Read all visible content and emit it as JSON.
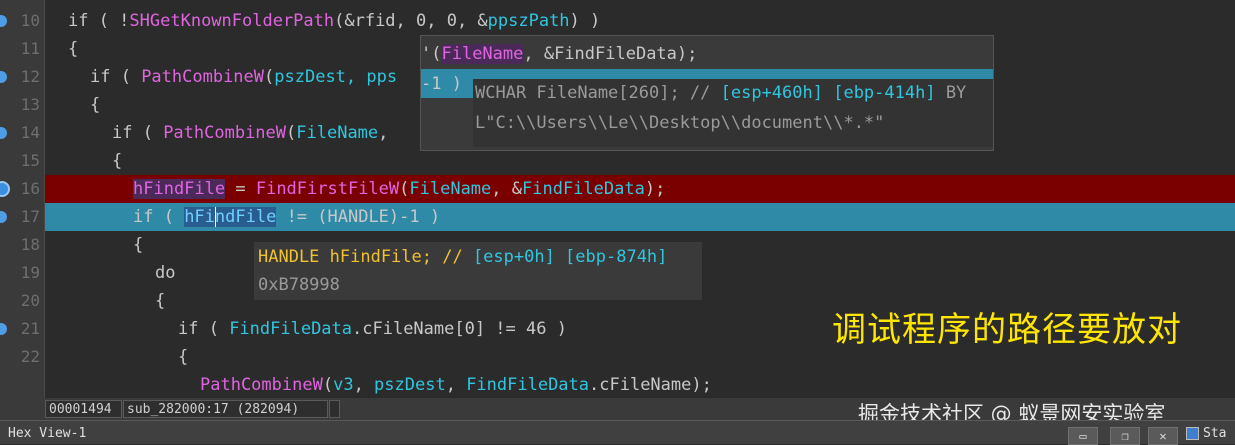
{
  "line_numbers": [
    "10",
    "11",
    "12",
    "13",
    "14",
    "15",
    "16",
    "17",
    "18",
    "19",
    "20",
    "21",
    "22"
  ],
  "code": {
    "l10": {
      "a": "if ( !",
      "fn": "SHGetKnownFolderPath",
      "b": "(&rfid, 0, 0, &",
      "v": "ppszPath",
      "c": ") )"
    },
    "l11": {
      "a": "{"
    },
    "l12": {
      "a": "if ( ",
      "fn": "PathCombineW",
      "b": "(",
      "v": "pszDest",
      "c": ", pps"
    },
    "l13": {
      "a": "{"
    },
    "l14": {
      "a": "if ( ",
      "fn": "PathCombineW",
      "b": "(",
      "v": "FileName",
      "c": ", "
    },
    "l15": {
      "a": "{"
    },
    "l16": {
      "v1": "hFindFile",
      "a": " = ",
      "fn": "FindFirstFileW",
      "b": "(",
      "v2": "FileName",
      "c": ", &",
      "v3": "FindFileData",
      "d": ");"
    },
    "l17": {
      "a": "if ( ",
      "v1a": "hFi",
      "v1b": "ndFile",
      "b": " != (HANDLE)-1 )"
    },
    "l18": {
      "a": "{"
    },
    "l19": {
      "a": "do"
    },
    "l20": {
      "a": "{"
    },
    "l21": {
      "a": "if ( ",
      "v": "FindFileData",
      "b": ".cFileName[0] != 46 )"
    },
    "l22": {
      "a": "{"
    },
    "l23": {
      "fn": "PathCombineW",
      "a": "(",
      "v1": "v3",
      "b": ", ",
      "v2": "pszDest",
      "c": ", ",
      "v3": "FindFileData",
      "d": ".cFileName);"
    }
  },
  "tooltip1": {
    "line0_a": "'(",
    "line0_var": "FileName",
    "line0_b": ", &FindFileData);",
    "line1": "-1 )",
    "decl_a": "WCHAR FileName[260]; // ",
    "decl_b": "[esp+460h] [ebp-414h]",
    "decl_c": " BY",
    "value": "L\"C:\\\\Users\\\\Le\\\\Desktop\\\\document\\\\*.*\""
  },
  "tooltip2": {
    "decl_a": "HANDLE hFindFile; // ",
    "decl_b": "[esp+0h] [ebp-874h]",
    "value": "0xB78998"
  },
  "overlay_text": "调试程序的路径要放对",
  "watermark": "掘金技术社区 @ 蚁景网安实验室",
  "status": {
    "address": "00001494",
    "location": "sub_282000:17 (282094)"
  },
  "bottom_bar": {
    "tab_label": "Hex View-1",
    "right_label": "Sta"
  },
  "colors": {
    "function": "#e064e0",
    "variable": "#2fc6e0",
    "breakpoint_line": "#7a0000",
    "current_line": "#2f8aa8",
    "overlay_text": "#ffe600"
  }
}
